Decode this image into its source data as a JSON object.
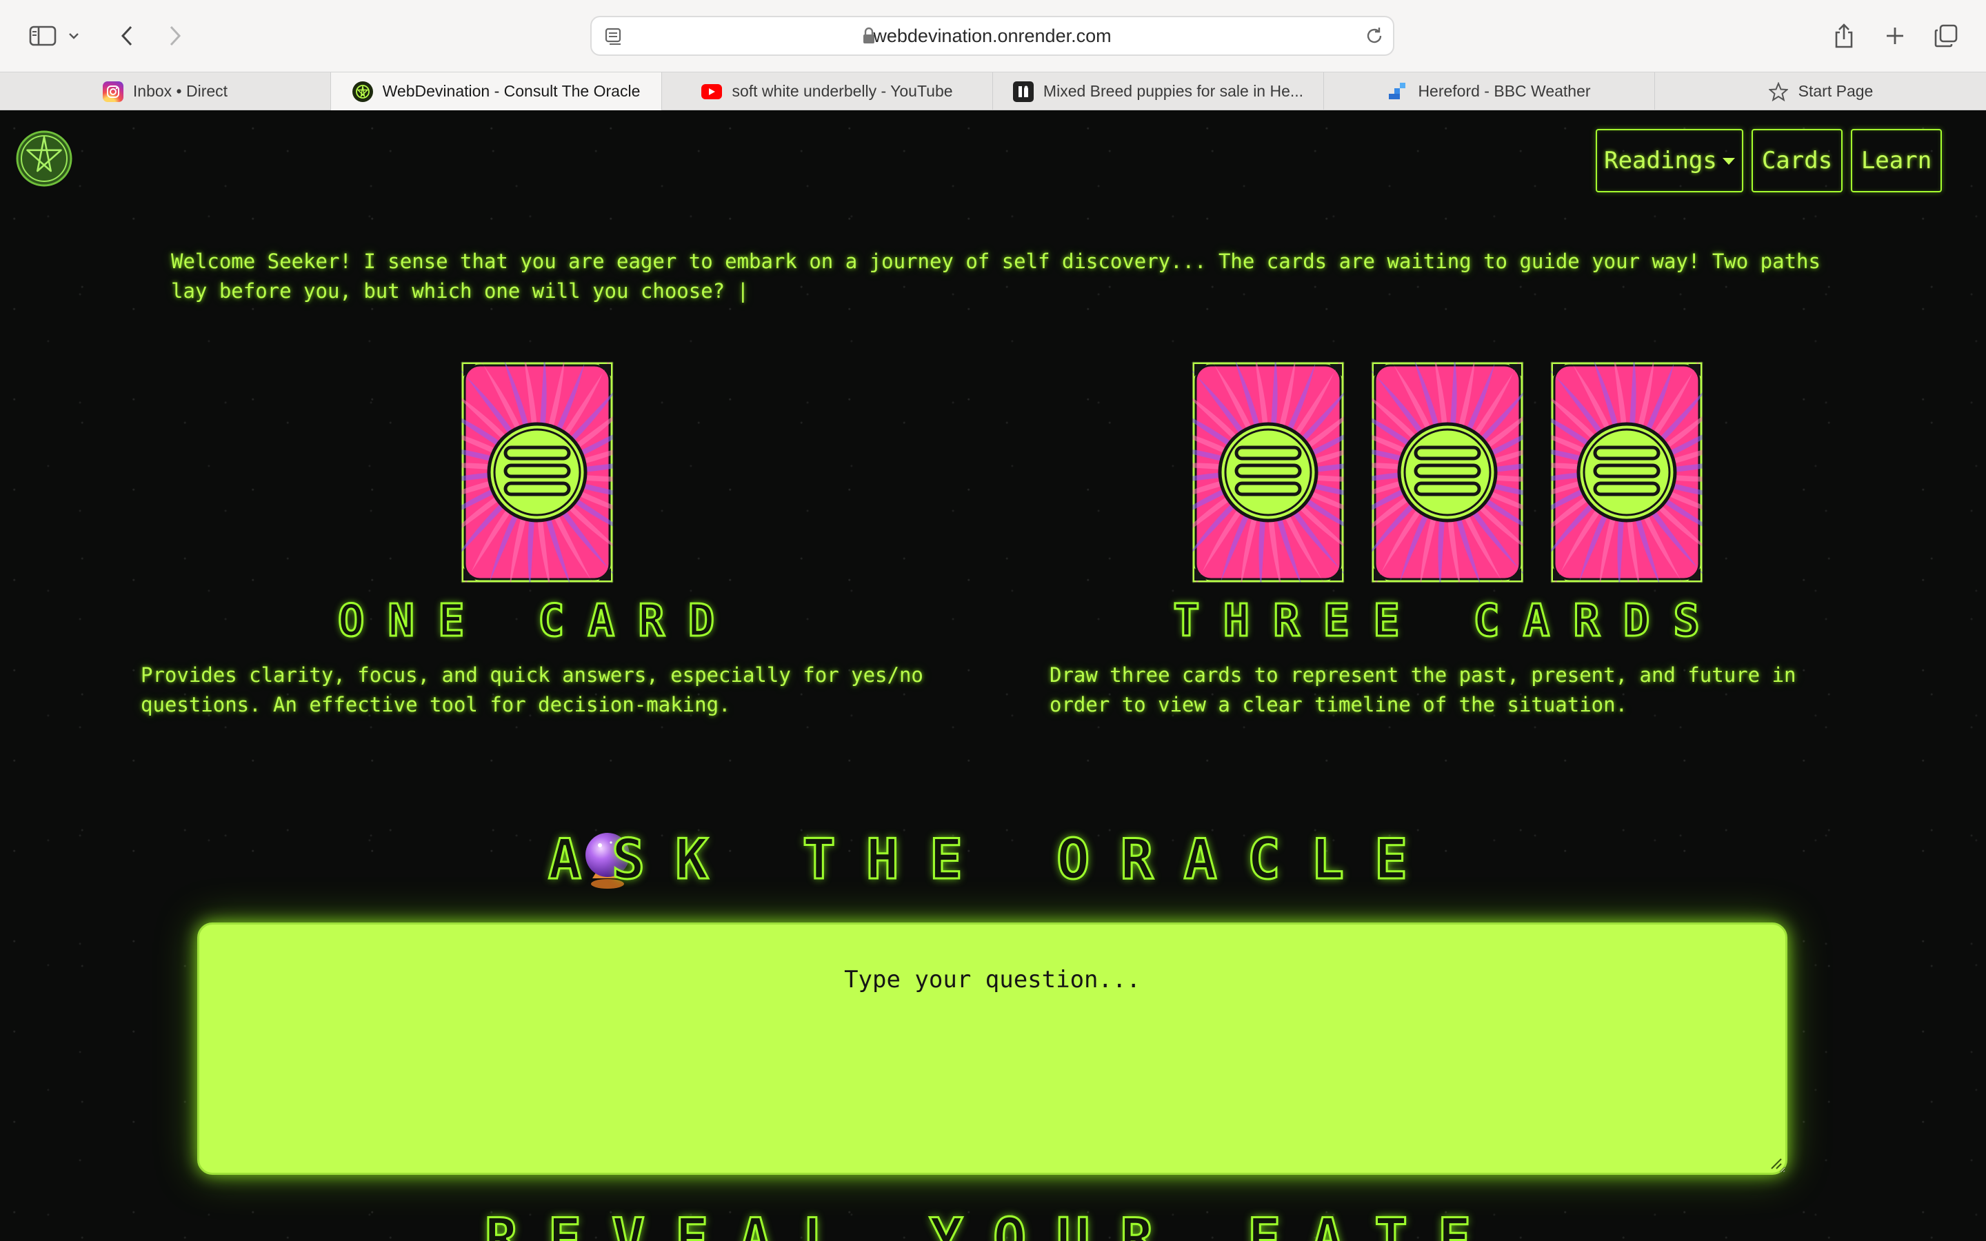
{
  "browser": {
    "url": "webdevination.onrender.com",
    "tabs": [
      {
        "label": "Inbox • Direct",
        "icon": "instagram-icon"
      },
      {
        "label": "WebDevination - Consult The Oracle",
        "icon": "webdevination-favicon",
        "active": true
      },
      {
        "label": "soft white underbelly - YouTube",
        "icon": "youtube-icon"
      },
      {
        "label": "Mixed Breed puppies for sale in He...",
        "icon": "puppies-favicon"
      },
      {
        "label": "Hereford - BBC Weather",
        "icon": "bbc-weather-icon"
      },
      {
        "label": "Start Page",
        "icon": "star-icon"
      }
    ]
  },
  "nav": {
    "readings": "Readings",
    "cards": "Cards",
    "learn": "Learn"
  },
  "intro": "Welcome Seeker! I sense that you are eager to embark on a journey of self discovery... The cards are waiting to guide your way! Two paths lay before you, but which one will you choose? |",
  "spreads": {
    "one": {
      "title": "ONE CARD",
      "description": "Provides clarity, focus, and quick answers, especially for yes/no questions. An effective tool for decision-making."
    },
    "three": {
      "title": "THREE CARDS",
      "description": "Draw three cards to represent the past, present, and future in order to view a clear timeline of the situation."
    }
  },
  "oracle": {
    "title": "ASK THE ORACLE",
    "placeholder": "Type your question..."
  },
  "reveal": "REVEAL YOUR FATE",
  "colors": {
    "neon": "#b9ff4a",
    "input_bg": "#c0ff50",
    "card_pink": "#ff3c8c",
    "card_purple": "#8a5cff",
    "page_bg": "#0b0c0b"
  }
}
